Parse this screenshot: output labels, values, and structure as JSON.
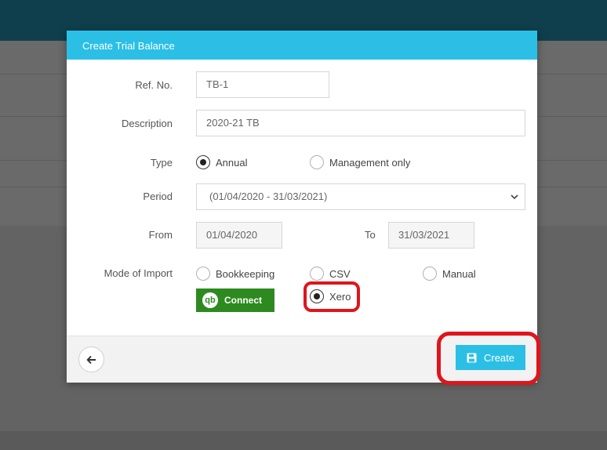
{
  "modal": {
    "title": "Create Trial Balance",
    "ref_label": "Ref. No.",
    "ref_value": "TB-1",
    "desc_label": "Description",
    "desc_value": "2020-21 TB",
    "type_label": "Type",
    "type_options": [
      {
        "label": "Annual",
        "selected": true
      },
      {
        "label": "Management only",
        "selected": false
      }
    ],
    "period_label": "Period",
    "period_value": "(01/04/2020 - 31/03/2021)",
    "from_label": "From",
    "from_value": "01/04/2020",
    "to_label": "To",
    "to_value": "31/03/2021",
    "import_label": "Mode of Import",
    "import_options": [
      {
        "label": "Bookkeeping",
        "selected": false
      },
      {
        "label": "CSV",
        "selected": false
      },
      {
        "label": "Manual",
        "selected": false
      },
      {
        "label": "Xero",
        "selected": true
      }
    ],
    "qb_connect_label": "Connect",
    "qb_logo_text": "qb",
    "create_label": "Create"
  },
  "colors": {
    "header": "#2bbfe6",
    "qb_green": "#2d8a1f",
    "highlight": "#e0141c"
  },
  "icons": [
    "chevron-down-icon",
    "qb-logo-icon",
    "back-arrow-icon",
    "save-icon"
  ]
}
